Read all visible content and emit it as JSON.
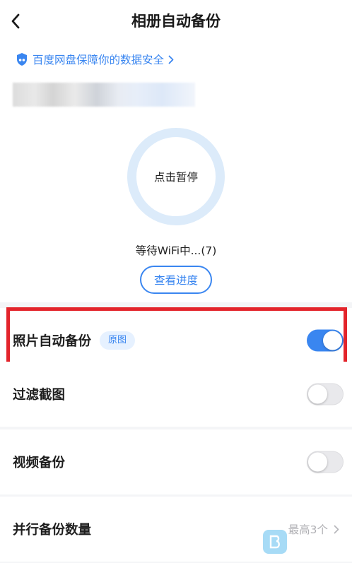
{
  "header": {
    "title": "相册自动备份",
    "back_icon": "chevron-left-icon"
  },
  "notice": {
    "text": "百度网盘保障你的数据安全",
    "icon": "shield-icon"
  },
  "status": {
    "ring_label": "点击暂停",
    "waiting_text": "等待WiFi中...(7)",
    "progress_button": "查看进度"
  },
  "settings": {
    "photo_backup": {
      "label": "照片自动备份",
      "badge": "原图",
      "enabled": true
    },
    "filter_screenshots": {
      "label": "过滤截图",
      "enabled": false
    },
    "video_backup": {
      "label": "视频备份",
      "enabled": false
    },
    "parallel_count": {
      "label": "并行备份数量",
      "value": "最高3个"
    }
  },
  "colors": {
    "accent": "#3a86f0",
    "highlight": "#e3242b",
    "ring": "#dcebfa"
  }
}
